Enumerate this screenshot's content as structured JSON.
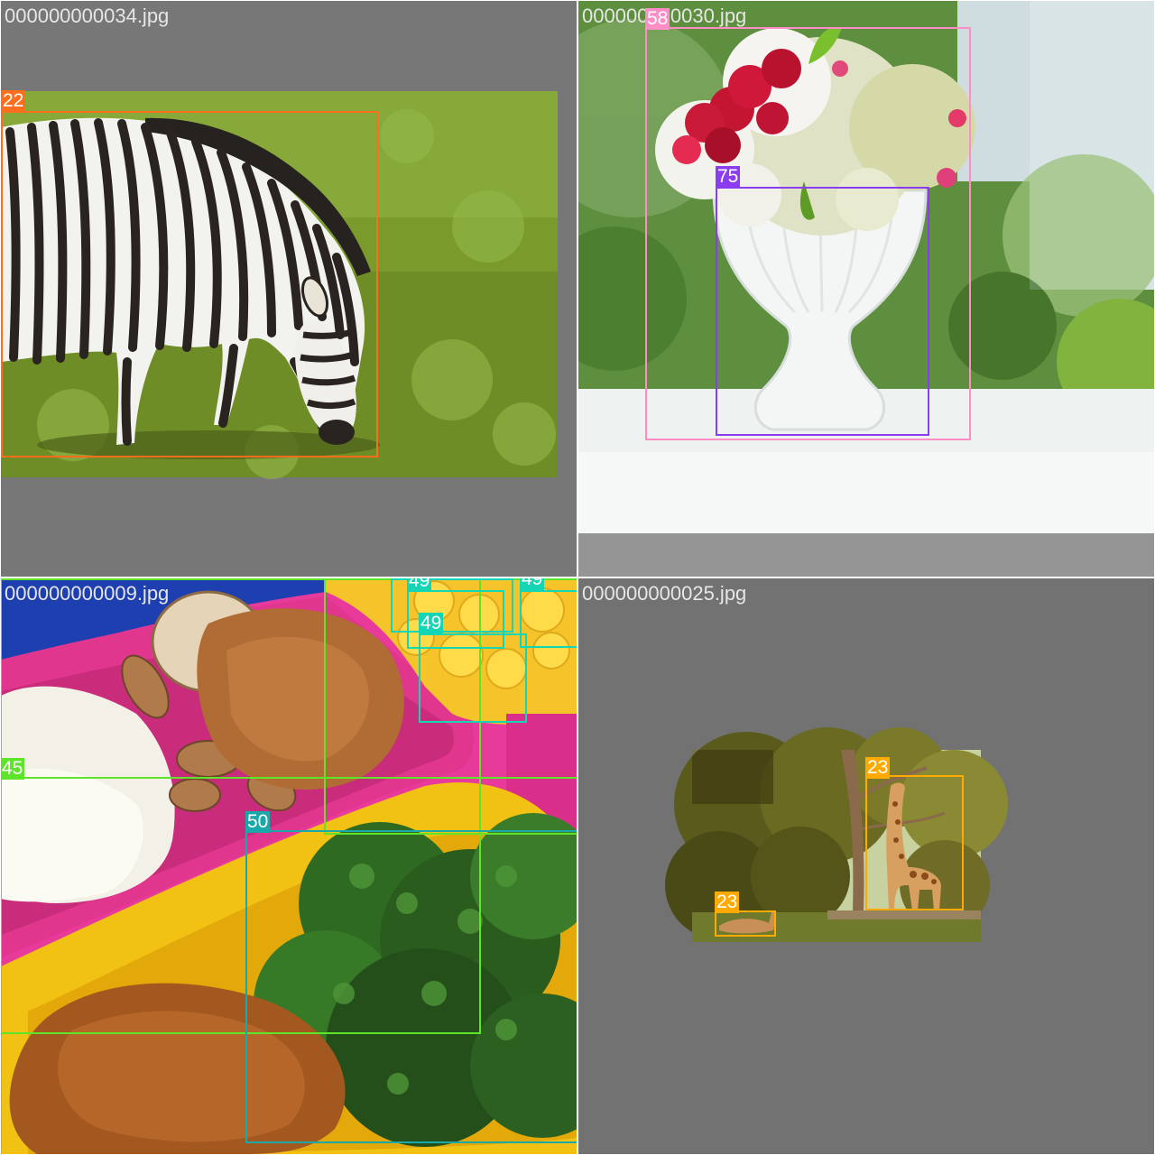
{
  "colors": {
    "background": "#ffffff",
    "tile_background": "#727272",
    "filename_text": "#e6e6e6",
    "label_text": "#ffffff",
    "class_22": "#ff6e1c",
    "class_23": "#ffaa00",
    "class_45": "#5ee52a",
    "class_49": "#14d6b4",
    "class_50": "#1aa8a8",
    "class_58": "#ff8ec6",
    "class_75": "#8c3cf0"
  },
  "tiles": [
    {
      "filename": "000000000034.jpg",
      "scene": "zebra-grazing",
      "detections": [
        {
          "label": "22",
          "color": "#ff6e1c"
        }
      ]
    },
    {
      "filename": "000000000030.jpg",
      "scene": "flower-vase",
      "detections": [
        {
          "label": "58",
          "color": "#ff8ec6"
        },
        {
          "label": "75",
          "color": "#8c3cf0"
        }
      ]
    },
    {
      "filename": "000000000009.jpg",
      "scene": "bento-lunch-boxes",
      "detections": [
        {
          "label": "45",
          "color": "#5ee52a"
        },
        {
          "label": "45",
          "color": "#5ee52a"
        },
        {
          "label": "45",
          "color": "#5ee52a"
        },
        {
          "label": "49",
          "color": "#14d6b4"
        },
        {
          "label": "49",
          "color": "#14d6b4"
        },
        {
          "label": "49",
          "color": "#14d6b4"
        },
        {
          "label": "49",
          "color": "#14d6b4"
        },
        {
          "label": "50",
          "color": "#1aa8a8"
        }
      ]
    },
    {
      "filename": "000000000025.jpg",
      "scene": "giraffes-in-trees",
      "detections": [
        {
          "label": "23",
          "color": "#ffaa00"
        },
        {
          "label": "23",
          "color": "#ffaa00"
        }
      ]
    }
  ]
}
